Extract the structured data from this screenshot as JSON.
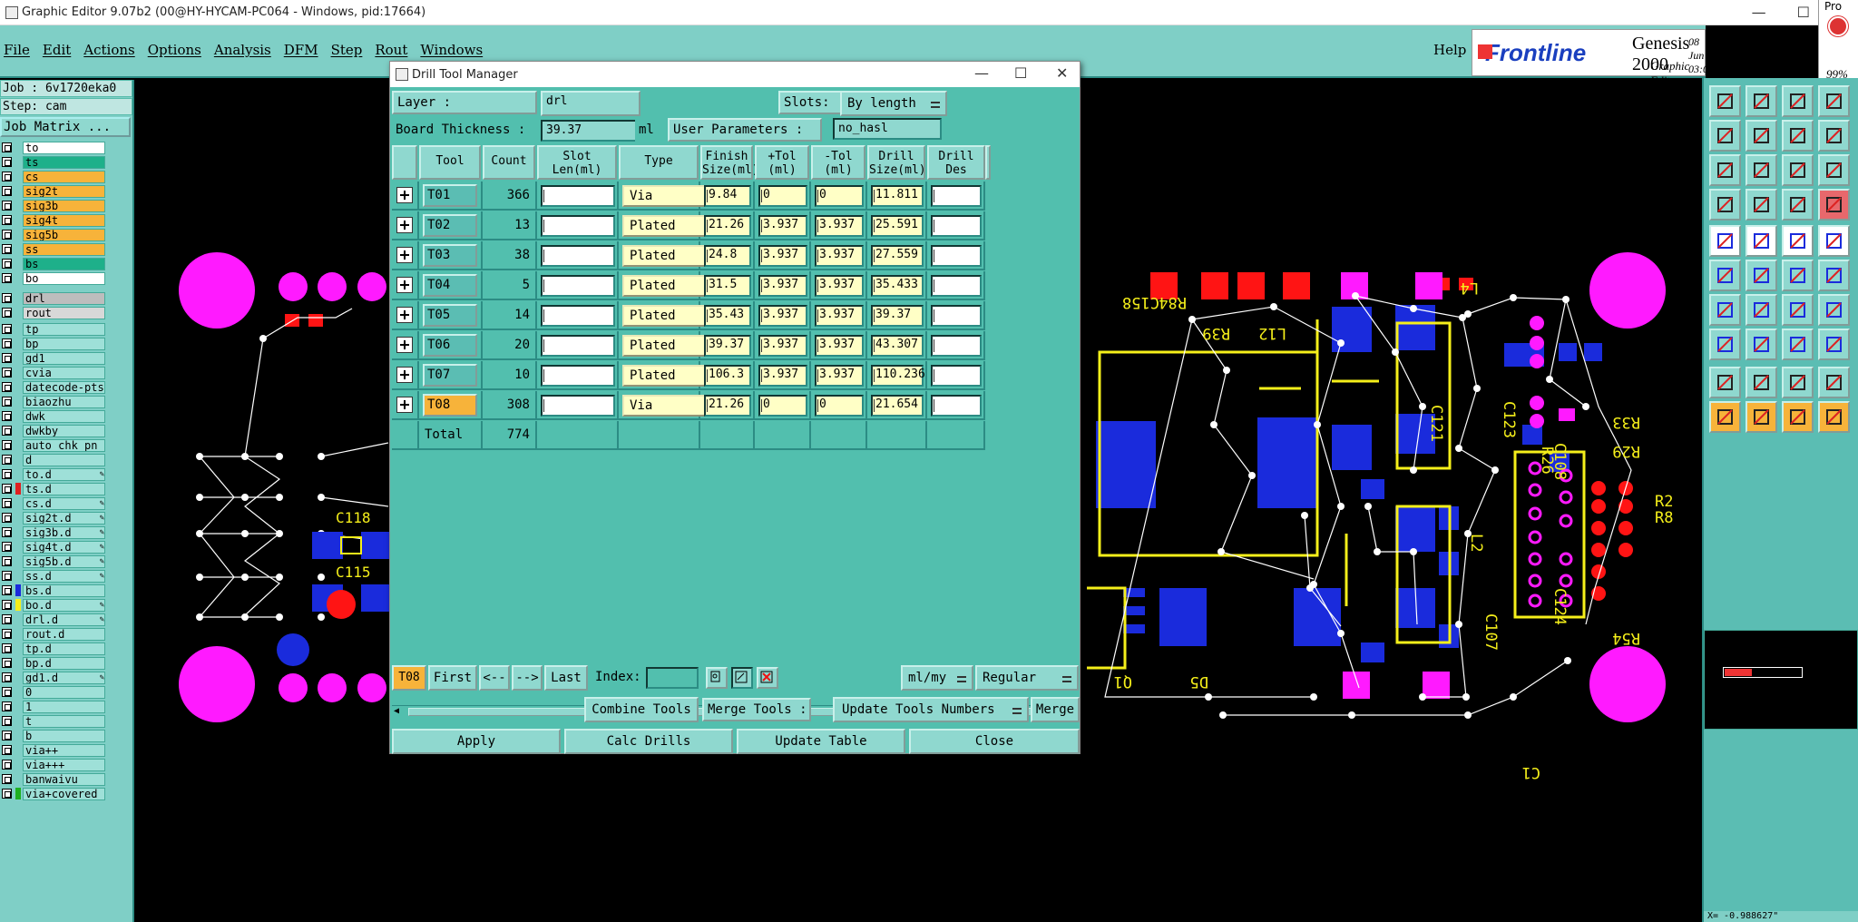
{
  "window": {
    "title": "Graphic Editor 9.07b2 (00@HY-HYCAM-PC064 - Windows, pid:17664)"
  },
  "menu": [
    "File",
    "Edit",
    "Actions",
    "Options",
    "Analysis",
    "DFM",
    "Step",
    "Rout",
    "Windows"
  ],
  "help": "Help",
  "brand": {
    "logo": "Frontline",
    "product": "Genesis 2000",
    "subtitle": "Graphic Editor",
    "date": "08 Jun",
    "time": "03:07"
  },
  "right_top": {
    "label": "Pro",
    "percent": "99%"
  },
  "job": {
    "job_line": "Job : 6v1720eka0",
    "step_line": "Step: cam",
    "matrix_button": "Job Matrix ..."
  },
  "layers": [
    {
      "name": "to",
      "color": "#ffffff",
      "swatch": ""
    },
    {
      "name": "ts",
      "color": "#1eb08a",
      "swatch": ""
    },
    {
      "name": "cs",
      "color": "#f7b33a",
      "swatch": ""
    },
    {
      "name": "sig2t",
      "color": "#f7b33a",
      "swatch": ""
    },
    {
      "name": "sig3b",
      "color": "#f7b33a",
      "swatch": ""
    },
    {
      "name": "sig4t",
      "color": "#f7b33a",
      "swatch": ""
    },
    {
      "name": "sig5b",
      "color": "#f7b33a",
      "swatch": ""
    },
    {
      "name": "ss",
      "color": "#f7b33a",
      "swatch": ""
    },
    {
      "name": "bs",
      "color": "#1eb08a",
      "swatch": ""
    },
    {
      "name": "bo",
      "color": "#ffffff",
      "swatch": ""
    },
    {
      "name": "drl",
      "color": "#bdbdbd",
      "swatch": ""
    },
    {
      "name": "rout",
      "color": "#d8d8d8",
      "swatch": ""
    },
    {
      "name": "tp",
      "color": "#9ee0d8",
      "swatch": ""
    },
    {
      "name": "bp",
      "color": "#9ee0d8",
      "swatch": ""
    },
    {
      "name": "gd1",
      "color": "#9ee0d8",
      "swatch": ""
    },
    {
      "name": "cvia",
      "color": "#9ee0d8",
      "swatch": ""
    },
    {
      "name": "datecode-pts",
      "color": "#9ee0d8",
      "swatch": ""
    },
    {
      "name": "biaozhu",
      "color": "#9ee0d8",
      "swatch": ""
    },
    {
      "name": "dwk",
      "color": "#9ee0d8",
      "swatch": ""
    },
    {
      "name": "dwkby",
      "color": "#9ee0d8",
      "swatch": ""
    },
    {
      "name": "auto_chk_pn",
      "color": "#9ee0d8",
      "swatch": ""
    },
    {
      "name": "d",
      "color": "#9ee0d8",
      "swatch": ""
    },
    {
      "name": "to.d",
      "color": "#9ee0d8",
      "swatch": "",
      "mark": true
    },
    {
      "name": "ts.d",
      "color": "#9ee0d8",
      "swatch": "#e02020"
    },
    {
      "name": "cs.d",
      "color": "#9ee0d8",
      "swatch": "",
      "mark": true
    },
    {
      "name": "sig2t.d",
      "color": "#9ee0d8",
      "swatch": "",
      "mark": true
    },
    {
      "name": "sig3b.d",
      "color": "#9ee0d8",
      "swatch": "",
      "mark": true
    },
    {
      "name": "sig4t.d",
      "color": "#9ee0d8",
      "swatch": "",
      "mark": true
    },
    {
      "name": "sig5b.d",
      "color": "#9ee0d8",
      "swatch": "",
      "mark": true
    },
    {
      "name": "ss.d",
      "color": "#9ee0d8",
      "swatch": "",
      "mark": true
    },
    {
      "name": "bs.d",
      "color": "#9ee0d8",
      "swatch": "#1a2bdc"
    },
    {
      "name": "bo.d",
      "color": "#9ee0d8",
      "swatch": "#f5ef1a",
      "mark": true
    },
    {
      "name": "drl.d",
      "color": "#9ee0d8",
      "swatch": "",
      "mark": true
    },
    {
      "name": "rout.d",
      "color": "#9ee0d8",
      "swatch": ""
    },
    {
      "name": "tp.d",
      "color": "#9ee0d8",
      "swatch": ""
    },
    {
      "name": "bp.d",
      "color": "#9ee0d8",
      "swatch": ""
    },
    {
      "name": "gd1.d",
      "color": "#9ee0d8",
      "swatch": "",
      "mark": true
    },
    {
      "name": "0",
      "color": "#9ee0d8",
      "swatch": ""
    },
    {
      "name": "1",
      "color": "#9ee0d8",
      "swatch": ""
    },
    {
      "name": "t",
      "color": "#9ee0d8",
      "swatch": ""
    },
    {
      "name": "b",
      "color": "#9ee0d8",
      "swatch": ""
    },
    {
      "name": "via++",
      "color": "#9ee0d8",
      "swatch": ""
    },
    {
      "name": "via+++",
      "color": "#9ee0d8",
      "swatch": ""
    },
    {
      "name": "banwaivu",
      "color": "#9ee0d8",
      "swatch": ""
    },
    {
      "name": "via+covered",
      "color": "#9ee0d8",
      "swatch": "#1eb020"
    }
  ],
  "dialog": {
    "title": "Drill Tool Manager",
    "layer_label": "Layer         :",
    "layer_value": "drl",
    "slots_label": "Slots:",
    "slots_value": "By length",
    "thickness_label": "Board Thickness :",
    "thickness_value": "39.37",
    "thickness_unit": "ml",
    "user_params_label": "User Parameters :",
    "user_params_value": "no_hasl",
    "columns": [
      {
        "l1": "Tool",
        "l2": ""
      },
      {
        "l1": "Count",
        "l2": ""
      },
      {
        "l1": "Slot",
        "l2": "Len(ml)"
      },
      {
        "l1": "Type",
        "l2": ""
      },
      {
        "l1": "Finish",
        "l2": "Size(ml)"
      },
      {
        "l1": "+Tol",
        "l2": "(ml)"
      },
      {
        "l1": "-Tol",
        "l2": "(ml)"
      },
      {
        "l1": "Drill",
        "l2": "Size(ml)"
      },
      {
        "l1": "Drill",
        "l2": "Des"
      }
    ],
    "rows": [
      {
        "tool": "T01",
        "count": "366",
        "slot": "",
        "type": "Via",
        "finish": "9.84",
        "ptol": "0",
        "mtol": "0",
        "drill": "11.811",
        "des": ""
      },
      {
        "tool": "T02",
        "count": "13",
        "slot": "",
        "type": "Plated",
        "finish": "21.26",
        "ptol": "3.937",
        "mtol": "3.937",
        "drill": "25.591",
        "des": ""
      },
      {
        "tool": "T03",
        "count": "38",
        "slot": "",
        "type": "Plated",
        "finish": "24.8",
        "ptol": "3.937",
        "mtol": "3.937",
        "drill": "27.559",
        "des": ""
      },
      {
        "tool": "T04",
        "count": "5",
        "slot": "",
        "type": "Plated",
        "finish": "31.5",
        "ptol": "3.937",
        "mtol": "3.937",
        "drill": "35.433",
        "des": ""
      },
      {
        "tool": "T05",
        "count": "14",
        "slot": "",
        "type": "Plated",
        "finish": "35.43",
        "ptol": "3.937",
        "mtol": "3.937",
        "drill": "39.37",
        "des": ""
      },
      {
        "tool": "T06",
        "count": "20",
        "slot": "",
        "type": "Plated",
        "finish": "39.37",
        "ptol": "3.937",
        "mtol": "3.937",
        "drill": "43.307",
        "des": ""
      },
      {
        "tool": "T07",
        "count": "10",
        "slot": "",
        "type": "Plated",
        "finish": "106.3",
        "ptol": "3.937",
        "mtol": "3.937",
        "drill": "110.236",
        "des": ""
      },
      {
        "tool": "T08",
        "count": "308",
        "slot": "",
        "type": "Via",
        "finish": "21.26",
        "ptol": "0",
        "mtol": "0",
        "drill": "21.654",
        "des": "",
        "selected": true
      }
    ],
    "total_label": "Total",
    "total_count": "774",
    "nav": {
      "current": "T08",
      "first": "First",
      "prev": "<--",
      "next": "-->",
      "last": "Last",
      "index_label": "Index:",
      "units": "ml/my",
      "mode": "Regular"
    },
    "actions": {
      "combine": "Combine Tools",
      "merge_label": "Merge Tools :",
      "update_numbers": "Update Tools Numbers",
      "merge": "Merge"
    },
    "footer": {
      "apply": "Apply",
      "calc": "Calc Drills",
      "update_table": "Update Table",
      "close": "Close"
    }
  },
  "coords": "X= -0.988627\""
}
